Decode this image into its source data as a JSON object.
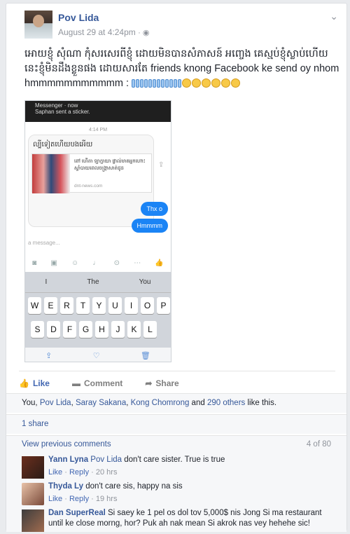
{
  "post": {
    "author": "Pov Lida",
    "time": "August 29 at 4:24pm",
    "privacy_icon": "globe-icon",
    "text": "អោយខ្ញុំ សុំណា កុំសរសេរពីខ្ញុំ ដោយមិនបានសំភាសន៍ អញ្ចេង គេស្មប់ខ្ញុំស្លាប់ហើយ នេះខ្ញុំមិនដឹងខ្លួនផង ដោយសារតែ friends knong Facebook ke send oy nhom hmmmmmmmmmmm :"
  },
  "screenshot": {
    "notification_app": "Messenger · now",
    "notification_text": "Saphan sent a sticker.",
    "time_label": "4:14 PM",
    "shared_caption": "ល្បីទៀតហើយបងអើយ",
    "link_title": "ពៅ ហើតា ឡាក្នាយា ផ្ទាល់មាតអ្នកហោះស្ទាំបាយពេលចង្រ្កាសាត់ជូន",
    "link_host": "dnt-news.com",
    "bubble1": "Thx o",
    "bubble2": "Hmmmm",
    "input_placeholder": "a message...",
    "suggestions": [
      "I",
      "The",
      "You"
    ],
    "keyboard_row1": [
      "W",
      "E",
      "R",
      "T",
      "Y",
      "U",
      "I",
      "O",
      "P"
    ],
    "keyboard_row2": [
      "S",
      "D",
      "F",
      "G",
      "H",
      "J",
      "K",
      "L"
    ]
  },
  "actions": {
    "like": "Like",
    "comment": "Comment",
    "share": "Share"
  },
  "likes": {
    "prefix": "You,",
    "names": [
      "Pov Lida",
      "Saray Sakana",
      "Kong Chomrong"
    ],
    "others": "290 others",
    "suffix": "like this."
  },
  "shares": "1 share",
  "view_previous": "View previous comments",
  "comment_count": "4 of 80",
  "comments": [
    {
      "name": "Yann Lyna",
      "mention": "Pov Lida",
      "text": "don't care sister. True is true",
      "like": "Like",
      "reply": "Reply",
      "time": "20 hrs"
    },
    {
      "name": "Thyda Ly",
      "mention": "",
      "text": "don't care sis, happy na sis",
      "like": "Like",
      "reply": "Reply",
      "time": "19 hrs"
    },
    {
      "name": "Dan SuperReal",
      "mention": "",
      "text": "Si saey ke 1 pel os dol tov 5,000$ nis Jong Si ma restaurant until ke close morng, hor? Puk ah nak mean Si akrok nas vey hehehe sic!",
      "like": "",
      "reply": "",
      "time": ""
    }
  ],
  "colors": {
    "link": "#365899",
    "like_blue": "#4267b2",
    "bubble_blue": "#1b84f5",
    "page_bg": "#e9ebee"
  }
}
